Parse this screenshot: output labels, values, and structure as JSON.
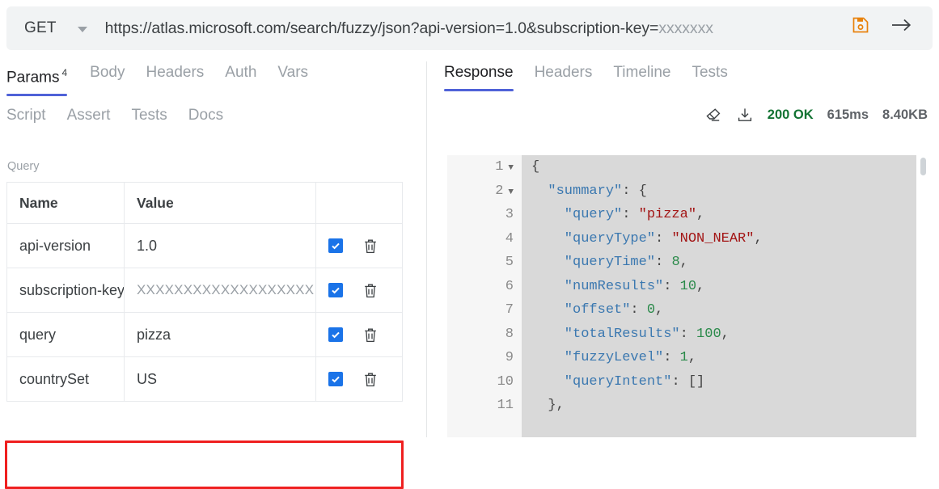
{
  "request_bar": {
    "method": "GET",
    "method_caret_icon": "chevron-down-icon",
    "url_visible": "https://atlas.microsoft.com/search/fuzzy/json?api-version=1.0&subscription-key=",
    "url_masked_suffix": "xxxxxxx",
    "save_icon": "save-floppy-icon",
    "send_icon": "arrow-right-icon",
    "save_icon_color": "#e8820c",
    "background": "#f1f3f4"
  },
  "left_panel": {
    "tabs_row1": [
      {
        "label": "Params",
        "badge": "4",
        "active": true
      },
      {
        "label": "Body",
        "badge": "",
        "active": false
      },
      {
        "label": "Headers",
        "badge": "",
        "active": false
      },
      {
        "label": "Auth",
        "badge": "",
        "active": false
      },
      {
        "label": "Vars",
        "badge": "",
        "active": false
      }
    ],
    "tabs_row2": [
      {
        "label": "Script",
        "active": false
      },
      {
        "label": "Assert",
        "active": false
      },
      {
        "label": "Tests",
        "active": false
      },
      {
        "label": "Docs",
        "active": false
      }
    ],
    "section_label": "Query",
    "table": {
      "columns": [
        "Name",
        "Value",
        ""
      ],
      "rows": [
        {
          "name": "api-version",
          "value": "1.0",
          "masked": false,
          "enabled": true,
          "highlighted": false
        },
        {
          "name": "subscription-key",
          "value": "XXXXXXXXXXXXXXXXXXX",
          "masked": true,
          "enabled": true,
          "highlighted": false
        },
        {
          "name": "query",
          "value": "pizza",
          "masked": false,
          "enabled": true,
          "highlighted": false
        },
        {
          "name": "countrySet",
          "value": "US",
          "masked": false,
          "enabled": true,
          "highlighted": true
        }
      ],
      "checkbox_color": "#1a73e8",
      "delete_icon": "trash-icon",
      "highlight_color": "#ef1f1f"
    }
  },
  "right_panel": {
    "tabs": [
      {
        "label": "Response",
        "active": true
      },
      {
        "label": "Headers",
        "active": false
      },
      {
        "label": "Timeline",
        "active": false
      },
      {
        "label": "Tests",
        "active": false
      }
    ],
    "meta": {
      "clear_icon": "eraser-icon",
      "download_icon": "download-icon",
      "status": "200 OK",
      "status_color": "#137333",
      "time": "615ms",
      "size": "8.40KB"
    },
    "response_body": {
      "language": "json",
      "lines": [
        {
          "n": "1",
          "fold": true,
          "tokens": [
            {
              "t": "punc",
              "v": "{"
            }
          ]
        },
        {
          "n": "2",
          "fold": true,
          "tokens": [
            {
              "t": "key",
              "v": "  \"summary\""
            },
            {
              "t": "punc",
              "v": ": {"
            }
          ]
        },
        {
          "n": "3",
          "fold": false,
          "tokens": [
            {
              "t": "key",
              "v": "    \"query\""
            },
            {
              "t": "punc",
              "v": ": "
            },
            {
              "t": "str",
              "v": "\"pizza\""
            },
            {
              "t": "punc",
              "v": ","
            }
          ]
        },
        {
          "n": "4",
          "fold": false,
          "tokens": [
            {
              "t": "key",
              "v": "    \"queryType\""
            },
            {
              "t": "punc",
              "v": ": "
            },
            {
              "t": "str",
              "v": "\"NON_NEAR\""
            },
            {
              "t": "punc",
              "v": ","
            }
          ]
        },
        {
          "n": "5",
          "fold": false,
          "tokens": [
            {
              "t": "key",
              "v": "    \"queryTime\""
            },
            {
              "t": "punc",
              "v": ": "
            },
            {
              "t": "num",
              "v": "8"
            },
            {
              "t": "punc",
              "v": ","
            }
          ]
        },
        {
          "n": "6",
          "fold": false,
          "tokens": [
            {
              "t": "key",
              "v": "    \"numResults\""
            },
            {
              "t": "punc",
              "v": ": "
            },
            {
              "t": "num",
              "v": "10"
            },
            {
              "t": "punc",
              "v": ","
            }
          ]
        },
        {
          "n": "7",
          "fold": false,
          "tokens": [
            {
              "t": "key",
              "v": "    \"offset\""
            },
            {
              "t": "punc",
              "v": ": "
            },
            {
              "t": "num",
              "v": "0"
            },
            {
              "t": "punc",
              "v": ","
            }
          ]
        },
        {
          "n": "8",
          "fold": false,
          "tokens": [
            {
              "t": "key",
              "v": "    \"totalResults\""
            },
            {
              "t": "punc",
              "v": ": "
            },
            {
              "t": "num",
              "v": "100"
            },
            {
              "t": "punc",
              "v": ","
            }
          ]
        },
        {
          "n": "9",
          "fold": false,
          "tokens": [
            {
              "t": "key",
              "v": "    \"fuzzyLevel\""
            },
            {
              "t": "punc",
              "v": ": "
            },
            {
              "t": "num",
              "v": "1"
            },
            {
              "t": "punc",
              "v": ","
            }
          ]
        },
        {
          "n": "10",
          "fold": false,
          "tokens": [
            {
              "t": "key",
              "v": "    \"queryIntent\""
            },
            {
              "t": "punc",
              "v": ": []"
            }
          ]
        },
        {
          "n": "11",
          "fold": false,
          "tokens": [
            {
              "t": "punc",
              "v": "  },"
            }
          ]
        }
      ]
    }
  }
}
